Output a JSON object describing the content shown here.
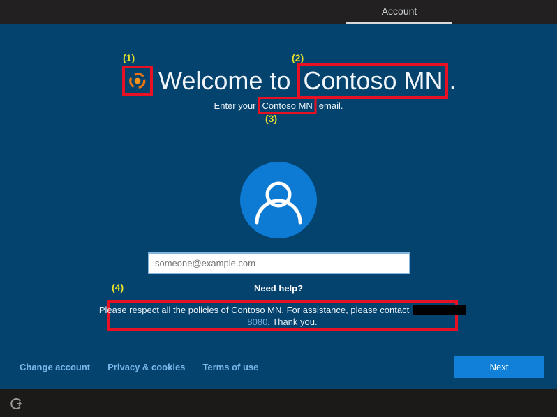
{
  "topbar": {
    "tab_label": "Account"
  },
  "annotations": {
    "label1": "(1)",
    "label2": "(2)",
    "label3": "(3)",
    "label4": "(4)",
    "box_color": "#e81123",
    "label_color": "#e7e32b"
  },
  "main": {
    "title_prefix": "Welcome to",
    "title_highlight": "Contoso MN",
    "title_suffix": ".",
    "subtitle_prefix": "Enter your",
    "subtitle_highlight": "Contoso MN",
    "subtitle_suffix": "email.",
    "email_value": "",
    "email_placeholder": "someone@example.com",
    "need_help_label": "Need help?",
    "notice_line1": "Please respect all the policies of Contoso MN. For assistance, please contact",
    "notice_redacted": "",
    "notice_link": "8080",
    "notice_line2_suffix": ". Thank you."
  },
  "footer": {
    "links": [
      "Change account",
      "Privacy & cookies",
      "Terms of use"
    ],
    "next_label": "Next"
  },
  "icons": {
    "logo": "contoso-swirl-logo",
    "avatar": "user-avatar-icon",
    "ease_of_access": "ease-of-access-icon"
  },
  "colors": {
    "background": "#03436e",
    "topbar": "#232021",
    "bottom_bar": "#1b1a19",
    "accent_button": "#1080d8",
    "avatar_circle": "#0d7ad4",
    "input_border": "#82b4de",
    "footer_link": "#79b7ea",
    "notice_link": "#79aede",
    "logo_orange": "#ee7a12"
  }
}
